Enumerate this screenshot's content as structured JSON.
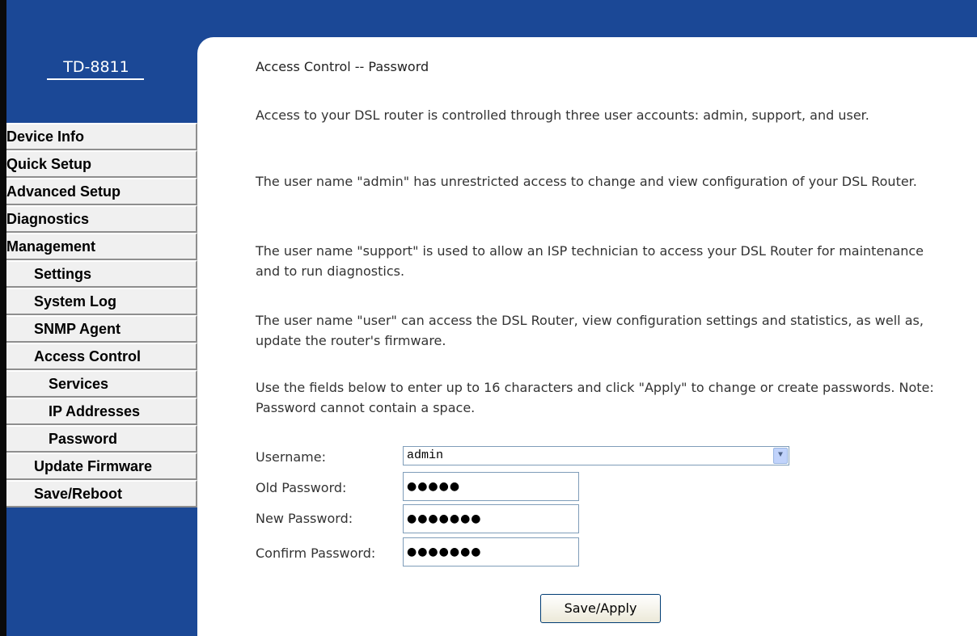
{
  "brand": "TD-8811",
  "sidebar": {
    "items": [
      {
        "label": "Device Info",
        "level": 0
      },
      {
        "label": "Quick Setup",
        "level": 0
      },
      {
        "label": "Advanced Setup",
        "level": 0
      },
      {
        "label": "Diagnostics",
        "level": 0
      },
      {
        "label": "Management",
        "level": 0
      },
      {
        "label": "Settings",
        "level": 1
      },
      {
        "label": "System Log",
        "level": 1
      },
      {
        "label": "SNMP Agent",
        "level": 1
      },
      {
        "label": "Access Control",
        "level": 1
      },
      {
        "label": "Services",
        "level": 2
      },
      {
        "label": "IP Addresses",
        "level": 2
      },
      {
        "label": "Password",
        "level": 2
      },
      {
        "label": "Update Firmware",
        "level": 1
      },
      {
        "label": "Save/Reboot",
        "level": 1
      }
    ]
  },
  "main": {
    "title": "Access Control -- Password",
    "paragraphs": [
      "Access to your DSL router is controlled through three user accounts: admin, support, and user.",
      "The user name \"admin\" has unrestricted access to change and view configuration of your DSL Router.",
      "The user name \"support\" is used to allow an ISP technician to access your DSL Router for maintenance and to run diagnostics.",
      "The user name \"user\" can access the DSL Router, view configuration settings and statistics, as well as, update the router's firmware.",
      "Use the fields below to enter up to 16 characters and click \"Apply\" to change or create passwords. Note: Password cannot contain a space."
    ],
    "form": {
      "username_label": "Username:",
      "username_value": "admin",
      "old_password_label": "Old Password:",
      "old_password_value": "●●●●●",
      "new_password_label": "New Password:",
      "new_password_value": "●●●●●●●",
      "confirm_password_label": "Confirm Password:",
      "confirm_password_value": "●●●●●●●",
      "dropdown_icon": "chevron-down-icon"
    },
    "save_button": "Save/Apply"
  },
  "colors": {
    "brand_blue": "#1b4896",
    "menu_bg": "#f0f0f0",
    "text": "#333333"
  }
}
